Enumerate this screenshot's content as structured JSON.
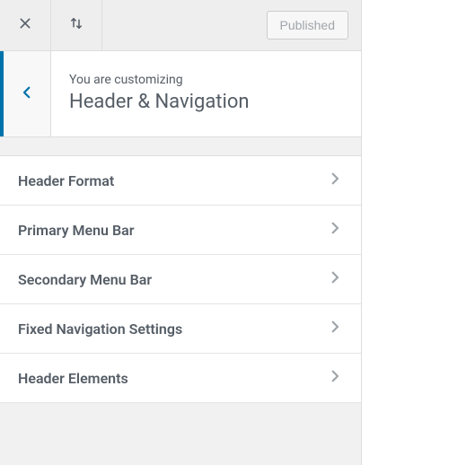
{
  "topbar": {
    "publish_label": "Published"
  },
  "header": {
    "customizing_label": "You are customizing",
    "section_title": "Header & Navigation"
  },
  "menu": {
    "items": [
      {
        "label": "Header Format"
      },
      {
        "label": "Primary Menu Bar"
      },
      {
        "label": "Secondary Menu Bar"
      },
      {
        "label": "Fixed Navigation Settings"
      },
      {
        "label": "Header Elements"
      }
    ]
  },
  "icons": {
    "close": "close-icon",
    "sort": "sort-arrows-icon",
    "back": "chevron-left-icon",
    "chevron": "chevron-right-icon"
  },
  "colors": {
    "accent": "#0073aa",
    "text_muted": "#555d66",
    "border": "#ddd",
    "panel_bg": "#f1f1f1"
  }
}
